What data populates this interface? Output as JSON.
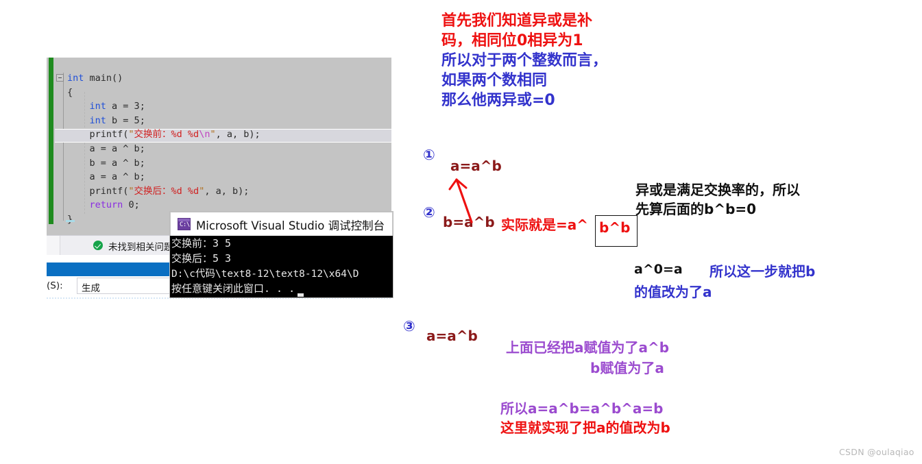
{
  "editor": {
    "code_lines": [
      {
        "id": "l1",
        "text": "int main()"
      },
      {
        "id": "l2",
        "text": "{"
      },
      {
        "id": "l3",
        "text": "    int a = 3;"
      },
      {
        "id": "l4",
        "text": "    int b = 5;"
      },
      {
        "id": "l5",
        "text": "    printf(\"交换前：%d %d\\n\", a, b);"
      },
      {
        "id": "l6",
        "text": "    a = a ^ b;"
      },
      {
        "id": "l7",
        "text": "    b = a ^ b;"
      },
      {
        "id": "l8",
        "text": "    a = a ^ b;"
      },
      {
        "id": "l9",
        "text": "    printf(\"交换后：%d %d\", a, b);"
      },
      {
        "id": "l10",
        "text": "    return 0;"
      },
      {
        "id": "l11",
        "text": "}"
      }
    ],
    "status_text": "未找到相关问题",
    "output_label": "(S):",
    "output_source": "生成"
  },
  "console": {
    "title": "Microsoft Visual Studio 调试控制台",
    "icon": "console-window-icon",
    "icon_glyph": "C:\\",
    "lines": [
      "交换前：3 5",
      "交换后：5 3",
      "D:\\c代码\\text8-12\\text8-12\\x64\\D",
      "按任意键关闭此窗口. . ."
    ]
  },
  "annotations": {
    "intro_red": "首先我们知道异或是补\n码，相同位0相异为1",
    "intro_blue": "所以对于两个整数而言，\n如果两个数相同\n那么他两异或=0",
    "step1_marker": "①",
    "step2_marker": "②",
    "step3_marker": "③",
    "step1_formula": "a=a^b",
    "step2_formula": "b=a^b",
    "step3_formula": "a=a^b",
    "actual_text": "实际就是=a^",
    "boxed_text": "b^b",
    "commutative": "异或是满足交换率的，所以\n先算后面的b^b=0",
    "a_xor_zero": "a^0=a",
    "step_effect": "所以这一步就把b",
    "step_effect2": "的值改为了a",
    "above_assign": "上面已经把a赋值为了a^b",
    "above_assign2": "b赋值为了a",
    "final_purple": "所以a=a^b=a^b^a=b",
    "final_red": "这里就实现了把a的值改为b"
  },
  "watermark": "CSDN @oulaqiao",
  "colors": {
    "red": "#ee1111",
    "blue": "#3333cc",
    "purple": "#9b4bcf",
    "black": "#111111",
    "change_bar_green": "#1f8b1f",
    "console_bg": "#000000",
    "editor_bg": "#c4c4c4"
  }
}
